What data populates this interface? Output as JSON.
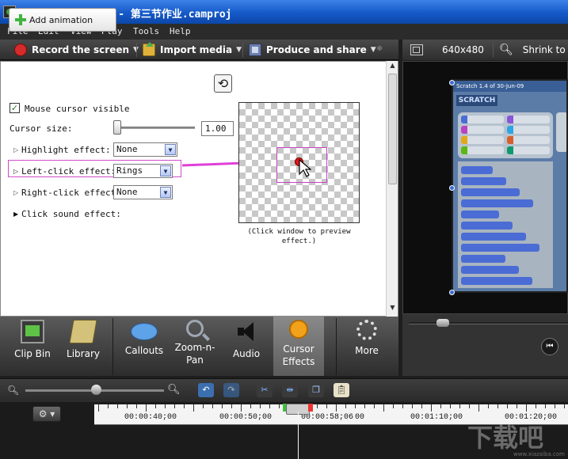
{
  "window": {
    "title": "Camtasia Studio - 第三节作业.camproj"
  },
  "menu": [
    "File",
    "Edit",
    "View",
    "Play",
    "Tools",
    "Help"
  ],
  "toolbar": {
    "record": "Record the screen",
    "import": "Import media",
    "produce": "Produce and share"
  },
  "preview_toolbar": {
    "size": "640x480",
    "shrink": "Shrink to fit"
  },
  "cursor_effects": {
    "add_animation": "Add animation",
    "mouse_cursor_visible_label": "Mouse cursor visible",
    "mouse_cursor_visible_checked": true,
    "cursor_size_label": "Cursor size:",
    "cursor_size_value": "1.00",
    "highlight_label": "Highlight effect:",
    "highlight_value": "None",
    "left_click_label": "Left-click effect:",
    "left_click_value": "Rings",
    "right_click_label": "Right-click effect",
    "right_click_value": "None",
    "click_sound_label": "Click sound effect:",
    "preview_caption_line1": "(Click window to preview",
    "preview_caption_line2": "effect.)"
  },
  "canvas_app": {
    "title": "Scratch 1.4 of 30-Jun-09",
    "logo": "SCRATCH",
    "category_colors": [
      "#4a6cd4",
      "#8a55d7",
      "#bb42c3",
      "#2ca5e2",
      "#e1a91a",
      "#d65f2d",
      "#5cb712",
      "#0e9a6c"
    ]
  },
  "tasks": [
    {
      "line1": "Clip Bin",
      "line2": "",
      "icon": "clip-bin-icon"
    },
    {
      "line1": "Library",
      "line2": "",
      "icon": "library-icon"
    },
    {
      "line1": "Callouts",
      "line2": "",
      "icon": "callouts-icon"
    },
    {
      "line1": "Zoom-n-",
      "line2": "Pan",
      "icon": "zoom-icon"
    },
    {
      "line1": "Audio",
      "line2": "",
      "icon": "audio-icon"
    },
    {
      "line1": "Cursor",
      "line2": "Effects",
      "icon": "cursor-icon"
    },
    {
      "line1": "More",
      "line2": "",
      "icon": "more-icon"
    }
  ],
  "timeline": {
    "ticks": [
      "00:00:40;00",
      "00:00:50;00",
      "00:00:58;06",
      "00",
      "00:01:10;00",
      "00:01:20;00"
    ]
  },
  "watermark": {
    "text": "下载吧",
    "url": "www.xiazaiba.com"
  }
}
